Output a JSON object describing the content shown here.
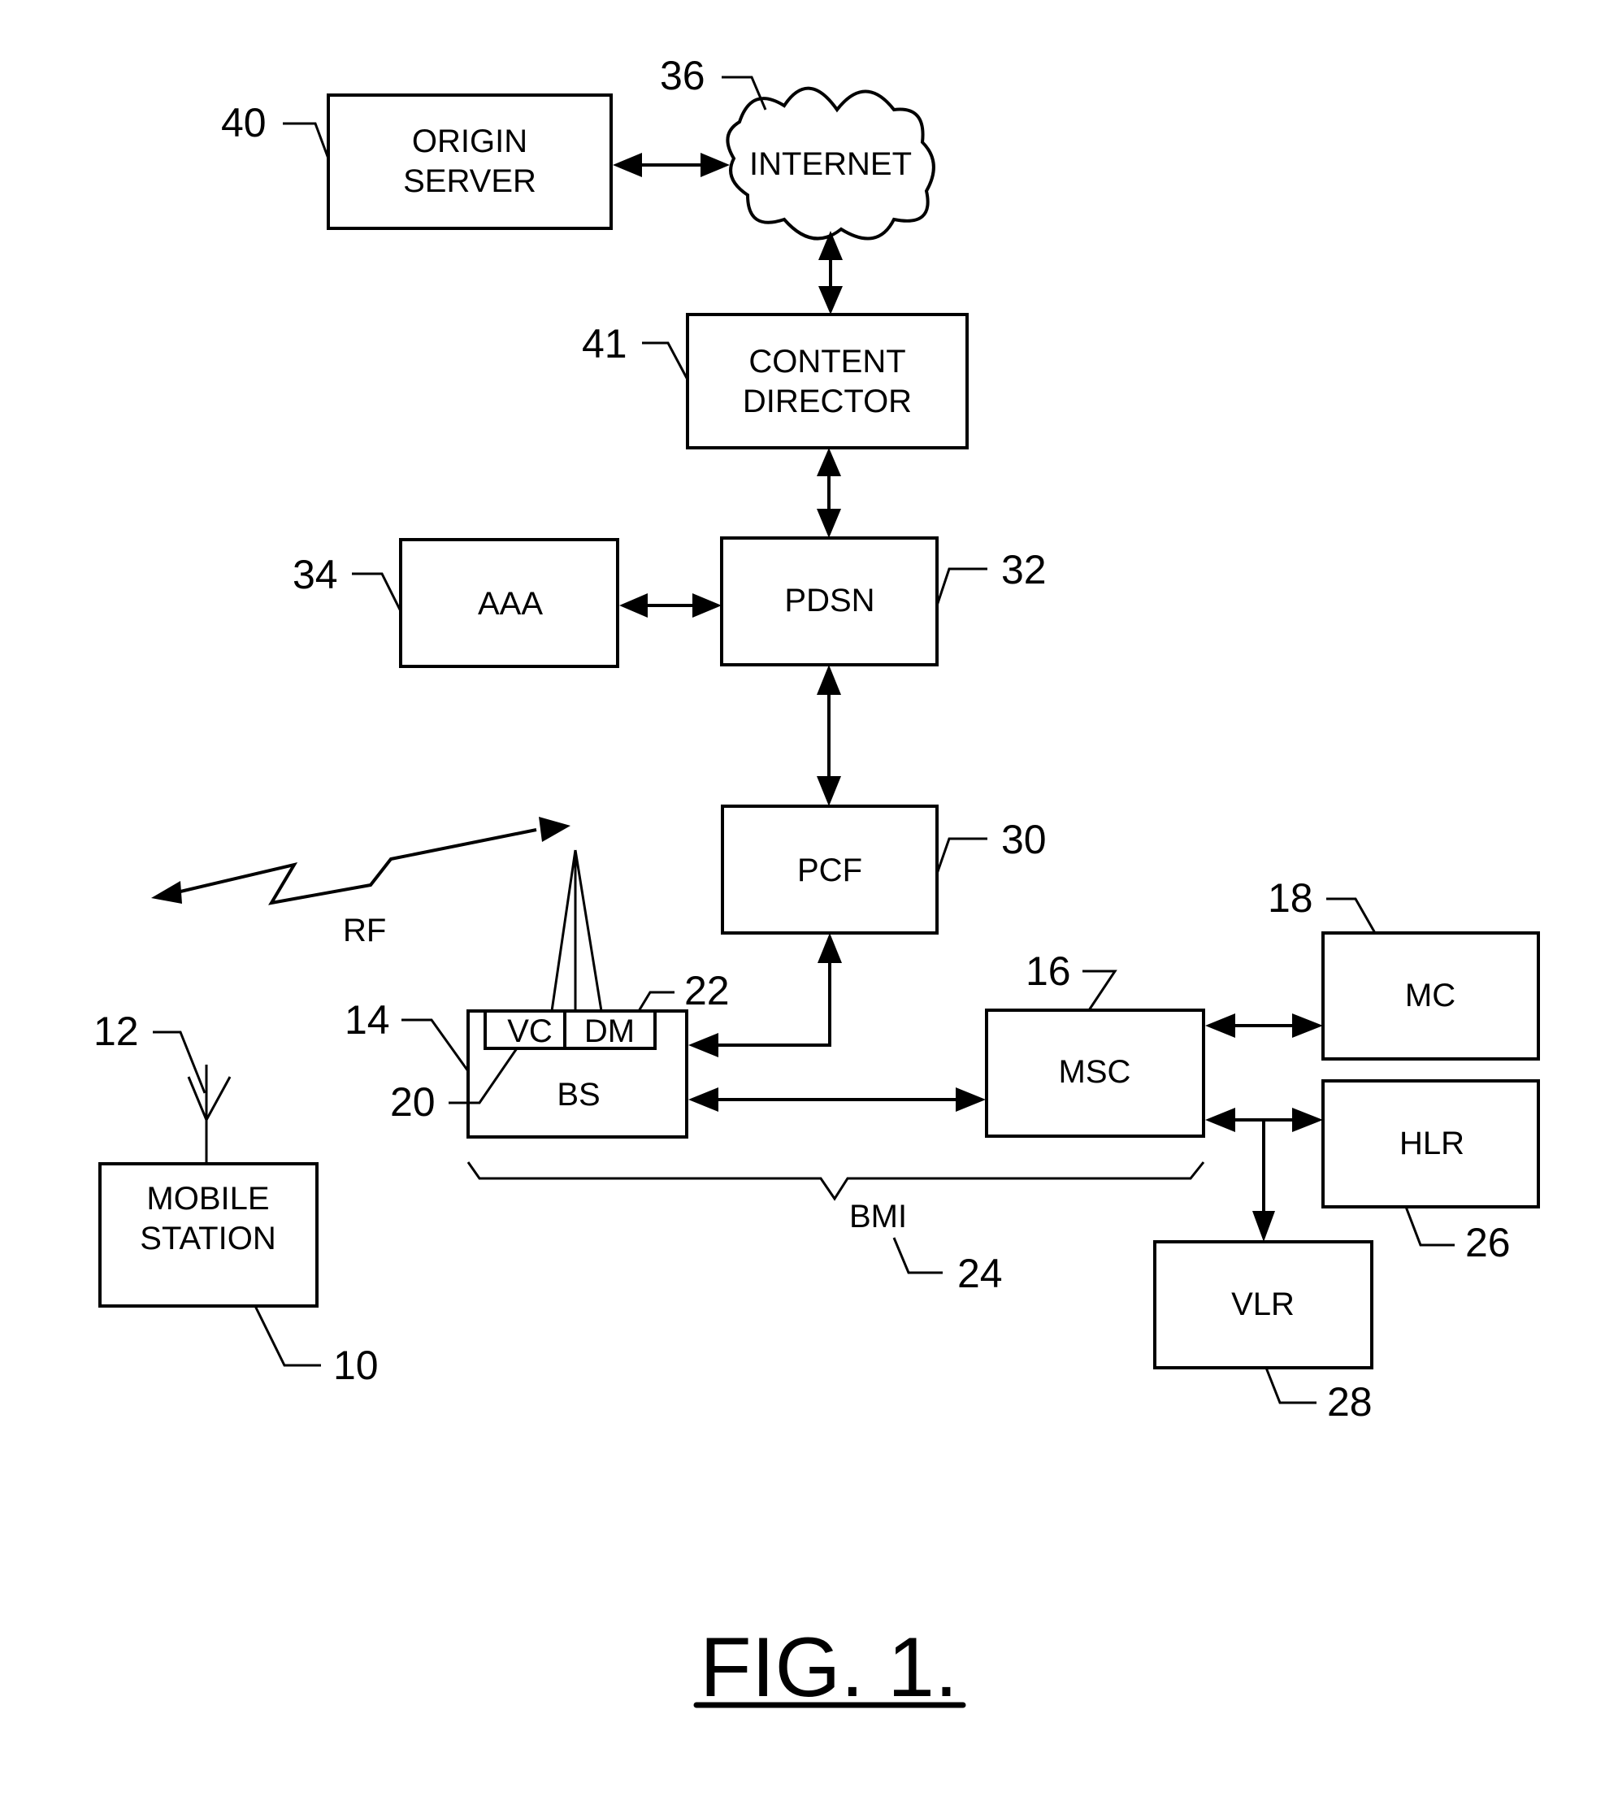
{
  "figure": {
    "caption": "FIG. 1."
  },
  "nodes": {
    "origin_server": {
      "line1": "ORIGIN",
      "line2": "SERVER",
      "ref": "40"
    },
    "internet": {
      "label": "INTERNET",
      "ref": "36"
    },
    "content_director": {
      "line1": "CONTENT",
      "line2": "DIRECTOR",
      "ref": "41"
    },
    "aaa": {
      "label": "AAA",
      "ref": "34"
    },
    "pdsn": {
      "label": "PDSN",
      "ref": "32"
    },
    "pcf": {
      "label": "PCF",
      "ref": "30"
    },
    "bs": {
      "label": "BS",
      "ref": "14"
    },
    "vc": {
      "label": "VC",
      "ref": "20"
    },
    "dm": {
      "label": "DM",
      "ref": "22"
    },
    "msc": {
      "label": "MSC",
      "ref": "16"
    },
    "mc": {
      "label": "MC",
      "ref": "18"
    },
    "hlr": {
      "label": "HLR",
      "ref": "26"
    },
    "vlr": {
      "label": "VLR",
      "ref": "28"
    },
    "mobile_station": {
      "line1": "MOBILE",
      "line2": "STATION",
      "ref": "10"
    },
    "ms_antenna": {
      "ref": "12"
    }
  },
  "annotations": {
    "rf": "RF",
    "bmi": "BMI",
    "bmi_ref": "24"
  },
  "connections": [
    {
      "from": "origin_server",
      "to": "internet",
      "type": "bidirectional"
    },
    {
      "from": "internet",
      "to": "content_director",
      "type": "bidirectional"
    },
    {
      "from": "content_director",
      "to": "pdsn",
      "type": "bidirectional"
    },
    {
      "from": "aaa",
      "to": "pdsn",
      "type": "bidirectional"
    },
    {
      "from": "pdsn",
      "to": "pcf",
      "type": "bidirectional"
    },
    {
      "from": "pcf",
      "to": "bs",
      "type": "bidirectional"
    },
    {
      "from": "bs",
      "to": "msc",
      "type": "bidirectional"
    },
    {
      "from": "msc",
      "to": "mc",
      "type": "bidirectional"
    },
    {
      "from": "msc",
      "to": "hlr",
      "type": "bidirectional"
    },
    {
      "from": "msc_hlr_link",
      "to": "vlr",
      "type": "directed"
    },
    {
      "from": "mobile_station",
      "to": "bs",
      "type": "rf-bidirectional"
    }
  ]
}
